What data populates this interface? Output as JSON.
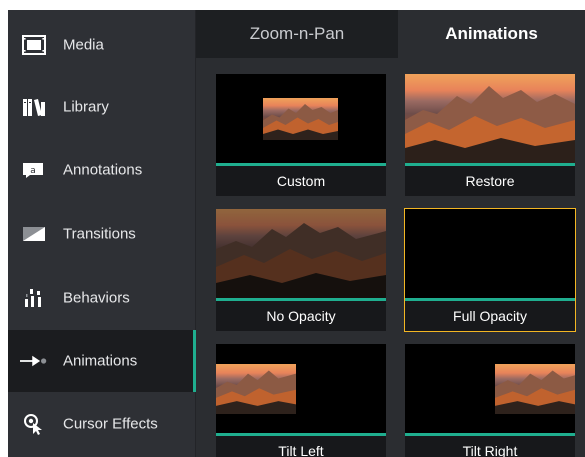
{
  "sidebar": {
    "items": [
      {
        "label": "Media",
        "icon": "film-strip-icon"
      },
      {
        "label": "Library",
        "icon": "books-icon"
      },
      {
        "label": "Annotations",
        "icon": "annotation-icon"
      },
      {
        "label": "Transitions",
        "icon": "transition-icon"
      },
      {
        "label": "Behaviors",
        "icon": "behaviors-icon"
      },
      {
        "label": "Animations",
        "icon": "animation-arrow-icon",
        "active": true
      },
      {
        "label": "Cursor Effects",
        "icon": "cursor-effects-icon"
      }
    ]
  },
  "tabs": [
    {
      "label": "Zoom-n-Pan"
    },
    {
      "label": "Animations",
      "active": true
    }
  ],
  "animations": [
    {
      "label": "Custom"
    },
    {
      "label": "Restore"
    },
    {
      "label": "No Opacity"
    },
    {
      "label": "Full Opacity",
      "selected": true
    },
    {
      "label": "Tilt Left"
    },
    {
      "label": "Tilt Right"
    }
  ],
  "colors": {
    "accent": "#1fae8f",
    "selection": "#f3b623",
    "sidebar_bg": "#2e3035",
    "panel_bg": "#2b2d31"
  }
}
